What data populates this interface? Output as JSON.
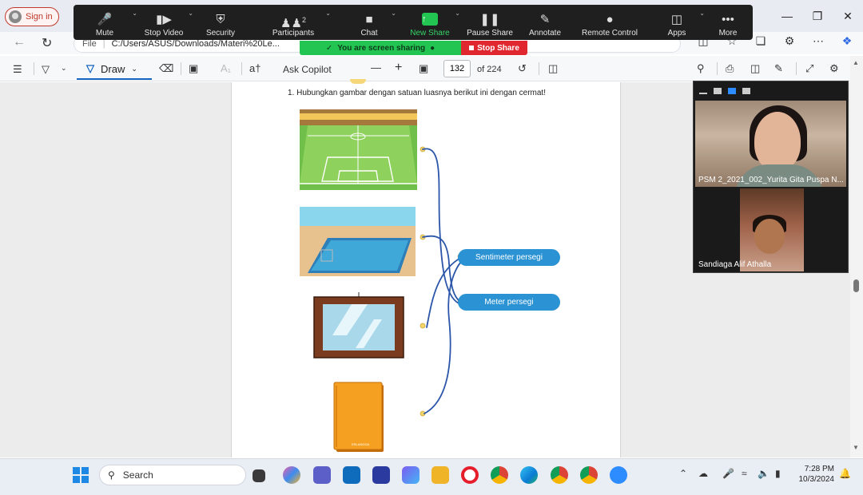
{
  "browser": {
    "signin_label": "Sign in",
    "url_prefix": "File",
    "url": "C:/Users/ASUS/Downloads/Materi%20Le..."
  },
  "zoom_toolbar": {
    "items": [
      {
        "label": "Mute",
        "icon": "mic-icon"
      },
      {
        "label": "Stop Video",
        "icon": "video-camera-icon"
      },
      {
        "label": "Security",
        "icon": "shield-icon"
      },
      {
        "label": "Participants",
        "icon": "participants-icon",
        "count": "2"
      },
      {
        "label": "Chat",
        "icon": "chat-icon"
      },
      {
        "label": "New Share",
        "icon": "share-arrow-icon"
      },
      {
        "label": "Pause Share",
        "icon": "pause-icon"
      },
      {
        "label": "Annotate",
        "icon": "pencil-icon"
      },
      {
        "label": "Remote Control",
        "icon": "mouse-icon"
      },
      {
        "label": "Apps",
        "icon": "apps-icon"
      },
      {
        "label": "More",
        "icon": "more-dots-icon"
      }
    ],
    "sharing_banner": "You are screen sharing",
    "stop_share_label": "Stop Share",
    "accent_green": "#23c552",
    "stop_red": "#e0262e"
  },
  "pdf_toolbar": {
    "draw_label": "Draw",
    "copilot_label": "Ask Copilot",
    "current_page": "132",
    "page_total": "of 224"
  },
  "document": {
    "question": "1.   Hubungkan gambar dengan satuan luasnya berikut ini dengan cermat!",
    "answers": [
      "Sentimeter persegi",
      "Meter persegi"
    ],
    "book_label": "ERLANGGA",
    "answer_color": "#2b93d3"
  },
  "gallery": {
    "participant1": "PSM 2_2021_002_Yurita Gita Puspa N...",
    "participant2": "Sandiaga Alif Athalla"
  },
  "taskbar": {
    "search_label": "Search",
    "time": "7:28 PM",
    "date": "10/3/2024"
  }
}
